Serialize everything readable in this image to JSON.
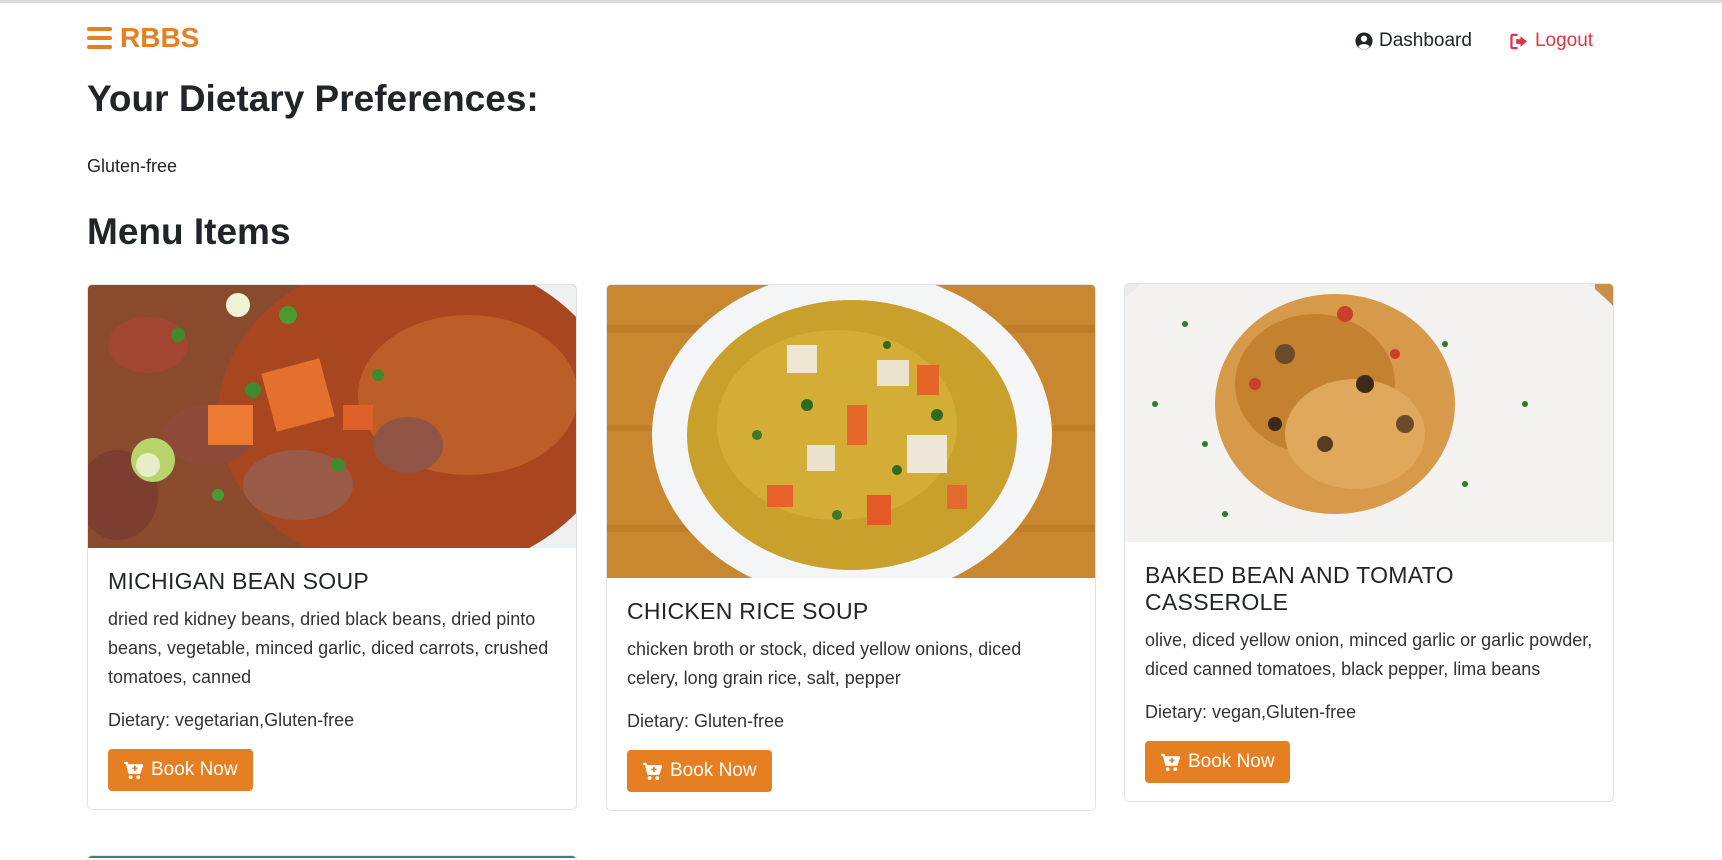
{
  "app": {
    "brand": "RBBS"
  },
  "nav": {
    "dashboard": "Dashboard",
    "logout": "Logout"
  },
  "preferences": {
    "heading": "Your Dietary Preferences:",
    "value": "Gluten-free"
  },
  "menu": {
    "heading": "Menu Items",
    "items": [
      {
        "title": "MICHIGAN BEAN SOUP",
        "description": "dried red kidney beans, dried black beans, dried pinto beans, vegetable, minced garlic, diced carrots, crushed tomatoes, canned",
        "dietary": "Dietary: vegetarian,Gluten-free",
        "button": "Book Now"
      },
      {
        "title": "CHICKEN RICE SOUP",
        "description": "chicken broth or stock, diced yellow onions, diced celery, long grain rice, salt, pepper",
        "dietary": "Dietary: Gluten-free",
        "button": "Book Now"
      },
      {
        "title": "BAKED BEAN AND TOMATO CASSEROLE",
        "description": "olive, diced yellow onion, minced garlic or garlic powder, diced canned tomatoes, black pepper, lima beans",
        "dietary": "Dietary: vegan,Gluten-free",
        "button": "Book Now"
      }
    ]
  },
  "colors": {
    "accent": "#e67e22",
    "logout": "#dc3545",
    "text": "#212529"
  },
  "icons": {
    "menu": "hamburger-icon",
    "user": "user-circle-icon",
    "logout": "sign-out-icon",
    "cart": "cart-plus-icon"
  }
}
